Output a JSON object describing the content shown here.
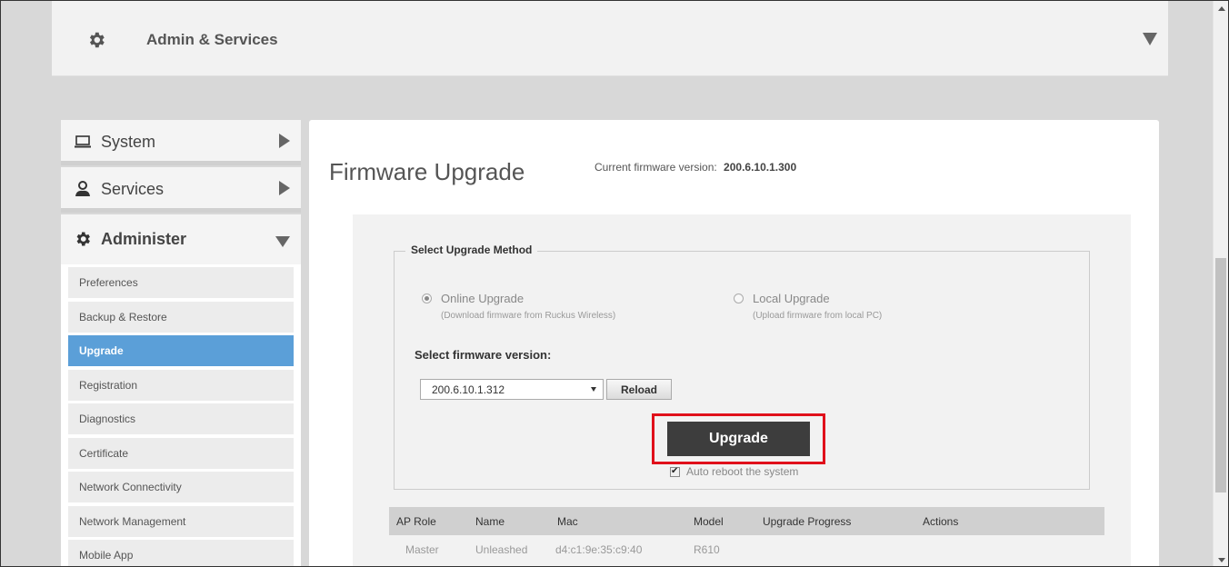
{
  "header": {
    "title": "Admin & Services"
  },
  "sidebar": {
    "sections": [
      {
        "label": "System",
        "icon": "laptop-icon"
      },
      {
        "label": "Services",
        "icon": "services-icon"
      },
      {
        "label": "Administer",
        "icon": "gear-icon"
      }
    ],
    "sub_items": [
      "Preferences",
      "Backup & Restore",
      "Upgrade",
      "Registration",
      "Diagnostics",
      "Certificate",
      "Network Connectivity",
      "Network Management",
      "Mobile App"
    ],
    "active_item": "Upgrade"
  },
  "main": {
    "title": "Firmware Upgrade",
    "current_fw_label": "Current firmware version:",
    "current_fw_value": "200.6.10.1.300",
    "method": {
      "legend": "Select Upgrade Method",
      "online_label": "Online Upgrade",
      "online_desc": "(Download firmware from Ruckus Wireless)",
      "local_label": "Local Upgrade",
      "local_desc": "(Upload firmware from local PC)",
      "selected": "online"
    },
    "select_label": "Select firmware version:",
    "selected_version": "200.6.10.1.312",
    "reload_label": "Reload",
    "upgrade_label": "Upgrade",
    "reboot_label": "Auto reboot the system",
    "reboot_checked": true,
    "table": {
      "headers": [
        "AP Role",
        "Name",
        "Mac",
        "Model",
        "Upgrade Progress",
        "Actions"
      ],
      "rows": [
        [
          "Master",
          "Unleashed",
          "d4:c1:9e:35:c9:40",
          "R610",
          "",
          ""
        ]
      ]
    }
  },
  "colors": {
    "active_nav": "#5b9fd8",
    "highlight": "#e0101b",
    "upgrade_button": "#3d3d3d"
  }
}
